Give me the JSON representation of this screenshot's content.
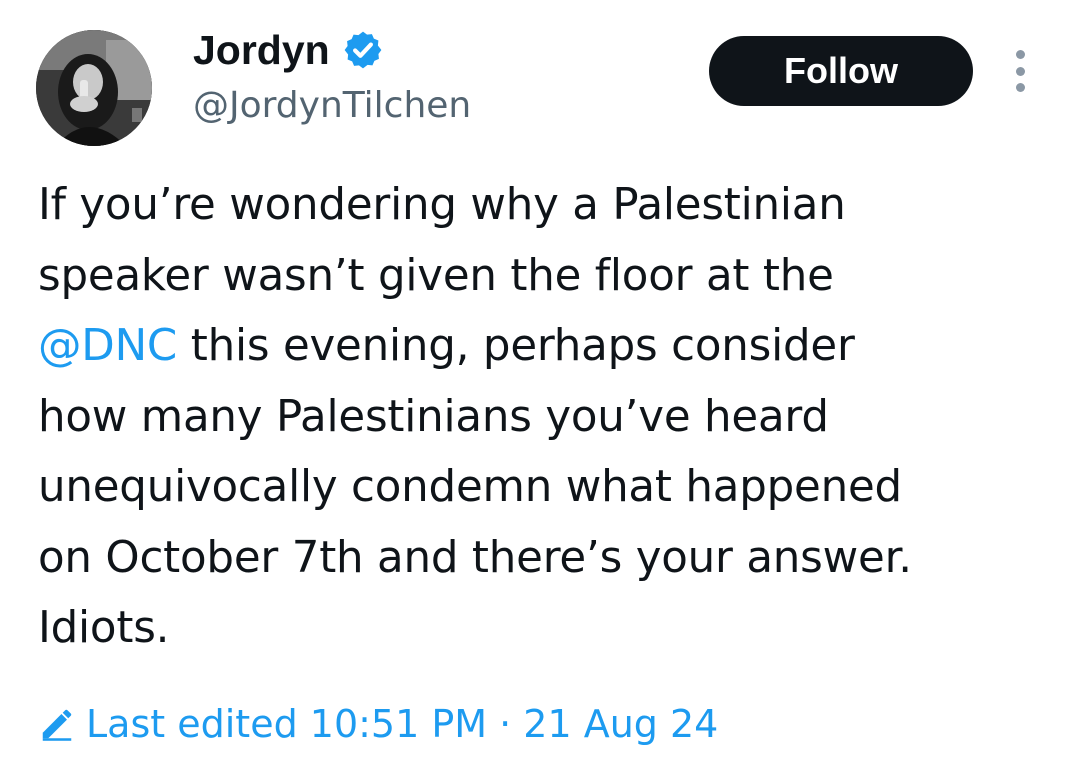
{
  "author": {
    "display_name": "Jordyn",
    "handle": "@JordynTilchen",
    "verified_icon": "verified-badge-icon",
    "verified_color": "#1d9bf0"
  },
  "actions": {
    "follow_label": "Follow",
    "more_icon": "more-vertical-icon"
  },
  "tweet": {
    "lines": [
      {
        "prefix": "If you’re wondering why a Palestinian"
      },
      {
        "prefix": "speaker wasn’t given the floor at the"
      },
      {
        "mention": "@DNC",
        "rest": " this evening, perhaps consider"
      },
      {
        "prefix": "how many Palestinians you’ve heard"
      },
      {
        "prefix": "unequivocally condemn what happened"
      },
      {
        "prefix": "on October 7th and there’s your answer."
      },
      {
        "prefix": "Idiots."
      }
    ]
  },
  "edited": {
    "icon": "pencil-icon",
    "label": "Last edited 10:51 PM · 21 Aug 24"
  },
  "colors": {
    "accent": "#1d9bf0",
    "text": "#0f1419",
    "secondary": "#536471",
    "button_bg": "#0f1419"
  }
}
